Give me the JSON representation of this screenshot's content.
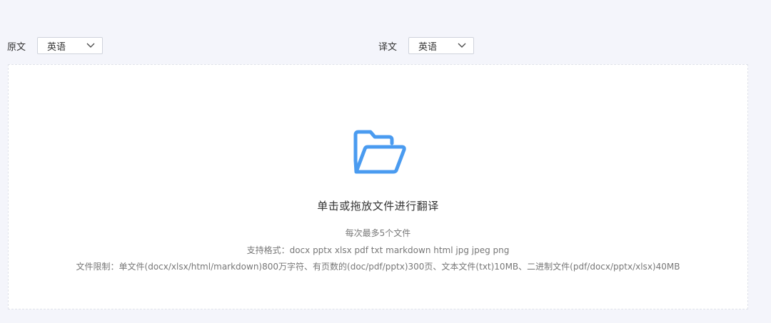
{
  "languages": {
    "source": {
      "label": "原文",
      "selected": "英语"
    },
    "target": {
      "label": "译文",
      "selected": "英语"
    }
  },
  "upload": {
    "main_text": "单击或拖放文件进行翻译",
    "hints": [
      "每次最多5个文件",
      "支持格式：docx pptx xlsx pdf txt markdown html jpg jpeg png",
      "文件限制：单文件(docx/xlsx/html/markdown)800万字符、有页数的(doc/pdf/pptx)300页、文本文件(txt)10MB、二进制文件(pdf/docx/pptx/xlsx)40MB"
    ]
  },
  "icons": {
    "folder": "folder-open-icon",
    "dropdown": "chevron-down-icon"
  },
  "colors": {
    "accent": "#4a9bf0",
    "background": "#f4f5fb",
    "panel": "#ffffff"
  }
}
